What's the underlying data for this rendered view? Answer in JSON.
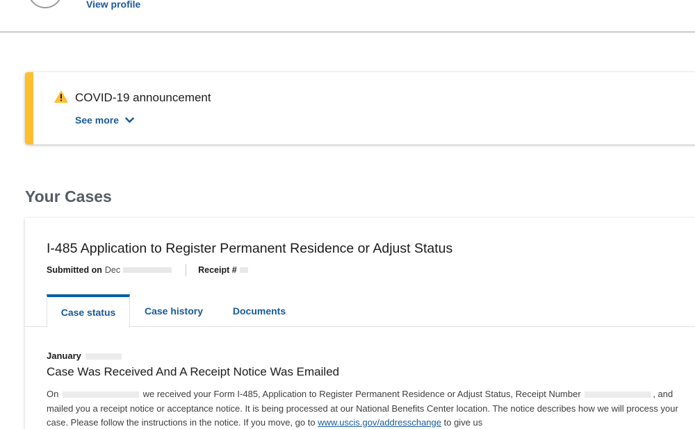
{
  "header": {
    "view_profile_label": "View profile"
  },
  "announcement": {
    "title": "COVID-19 announcement",
    "see_more_label": "See more",
    "accent_color": "#ffbe2e",
    "icon": "warning-triangle-icon"
  },
  "cases_heading": "Your Cases",
  "case": {
    "title": "I-485 Application to Register Permanent Residence or Adjust Status",
    "submitted_label": "Submitted on",
    "submitted_value": "Dec",
    "receipt_label": "Receipt #",
    "tabs": [
      {
        "label": "Case status",
        "active": true
      },
      {
        "label": "Case history",
        "active": false
      },
      {
        "label": "Documents",
        "active": false
      }
    ],
    "latest_update": {
      "date": "January",
      "title": "Case Was Received And A Receipt Notice Was Emailed",
      "body_part1": "On",
      "body_part2": "we received your Form I-485, Application to Register Permanent Residence or Adjust Status, Receipt Number",
      "body_part3": ", and mailed you a receipt notice or acceptance notice. It is being processed at our National Benefits Center location. The notice describes how we will process your case. Please follow the instructions in the notice. If you move, go to",
      "link_text": "www.uscis.gov/addresschange",
      "body_part4": "to give us"
    }
  },
  "colors": {
    "link": "#1a5a96",
    "active_tab_border": "#005ea2",
    "heading_gray": "#565c65"
  }
}
